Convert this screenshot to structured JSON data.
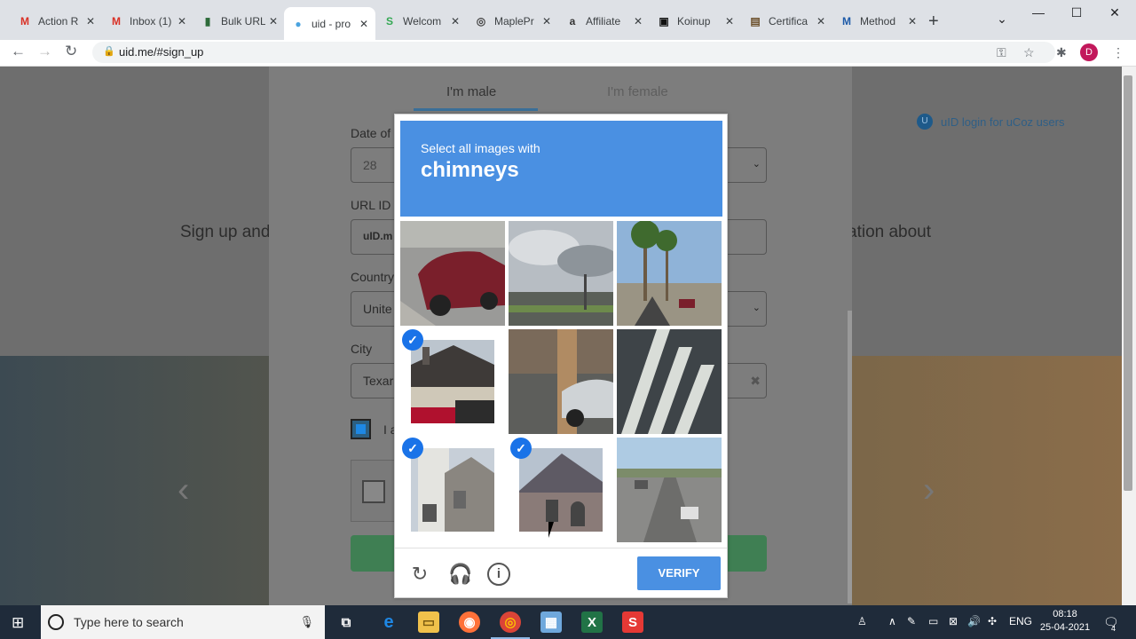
{
  "browser": {
    "tabs": [
      {
        "title": "Action R",
        "favicon": "M",
        "favicon_color": "#d93025"
      },
      {
        "title": "Inbox (1)",
        "favicon": "M",
        "favicon_color": "#d93025"
      },
      {
        "title": "Bulk URL",
        "favicon": "▮",
        "favicon_color": "#2d6b3a"
      },
      {
        "title": "uid - pro",
        "favicon": "●",
        "favicon_color": "#4aa3df"
      },
      {
        "title": "Welcom",
        "favicon": "S",
        "favicon_color": "#34a853"
      },
      {
        "title": "MaplePr",
        "favicon": "◎",
        "favicon_color": "#444"
      },
      {
        "title": "Affiliate",
        "favicon": "a",
        "favicon_color": "#333"
      },
      {
        "title": "Koinup",
        "favicon": "▣",
        "favicon_color": "#111"
      },
      {
        "title": "Certifica",
        "favicon": "▤",
        "favicon_color": "#6b4f2a"
      },
      {
        "title": "Method",
        "favicon": "M",
        "favicon_color": "#1d5aa8"
      }
    ],
    "active_tab_index": 3,
    "address": "uid.me/#sign_up",
    "avatar_initial": "D"
  },
  "page": {
    "tab_male": "I'm male",
    "tab_female": "I'm female",
    "uid_login": "uID login for uCoz users",
    "hero_left": "Sign up and",
    "hero_right": "ation about",
    "fields": {
      "dob_label": "Date of",
      "dob_value": "28",
      "url_label": "URL ID",
      "url_value": "uID.m",
      "country_label": "Country",
      "country_value": "Unite",
      "city_label": "City",
      "city_value": "Texar"
    },
    "agree_text": "I a"
  },
  "captcha": {
    "instruction": "Select all images with",
    "target": "chimneys",
    "verify_label": "VERIFY",
    "tiles_selected": [
      false,
      false,
      false,
      true,
      false,
      false,
      true,
      true,
      false
    ]
  },
  "taskbar": {
    "search_placeholder": "Type here to search",
    "language": "ENG",
    "time": "08:18",
    "date": "25-04-2021",
    "notification_count": "4"
  }
}
